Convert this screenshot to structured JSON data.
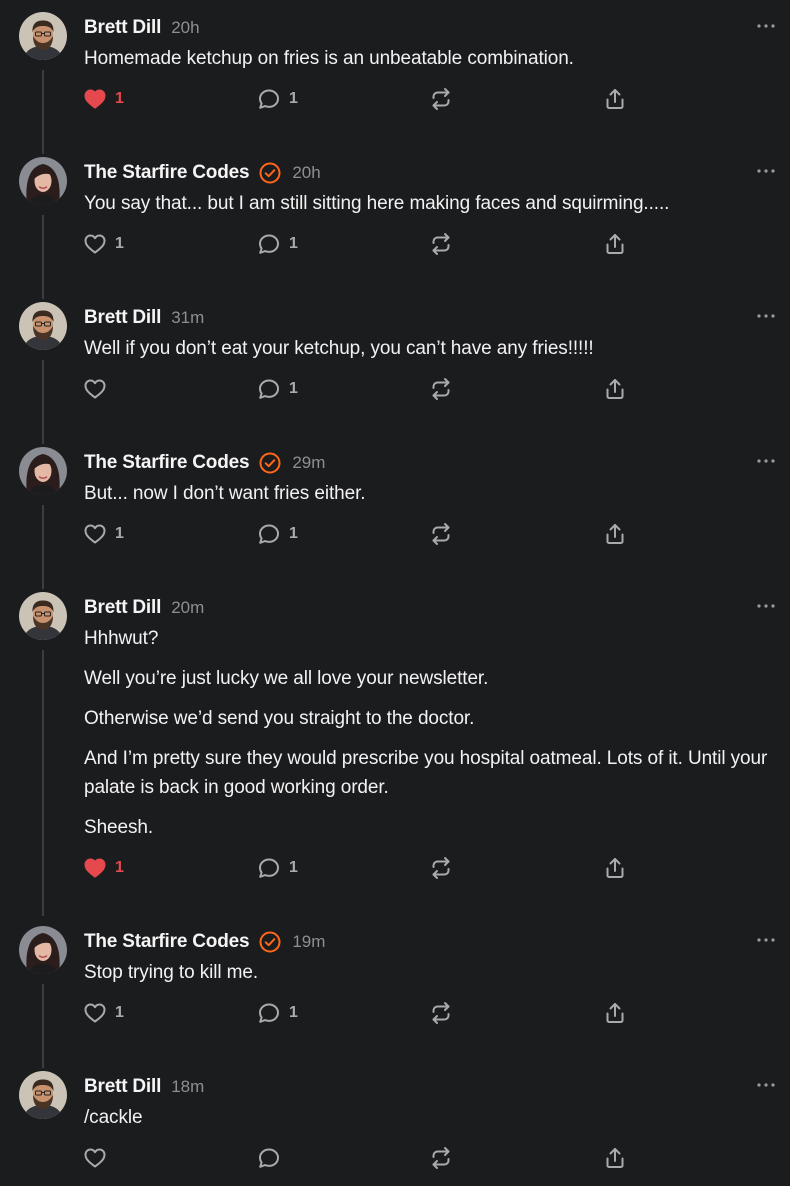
{
  "colors": {
    "background": "#1b1c1e",
    "text": "#f2f2f2",
    "muted": "#8e8f93",
    "like_active": "#e5484d",
    "verified_accent": "#ff6719",
    "thread_line": "#3c3d40"
  },
  "comments": [
    {
      "author": "Brett Dill",
      "time": "20h",
      "verified": false,
      "avatar": "bearded-man-avatar",
      "paragraphs": [
        "Homemade ketchup on fries is an unbeatable combination."
      ],
      "likes": "1",
      "liked": true,
      "replies": "1"
    },
    {
      "author": "The Starfire Codes",
      "time": "20h",
      "verified": true,
      "avatar": "dark-haired-woman-avatar",
      "paragraphs": [
        "You say that... but I am still sitting here making faces and squirming....."
      ],
      "likes": "1",
      "liked": false,
      "replies": "1"
    },
    {
      "author": "Brett Dill",
      "time": "31m",
      "verified": false,
      "avatar": "bearded-man-avatar",
      "paragraphs": [
        "Well if you don’t eat your ketchup, you can’t have any fries!!!!!"
      ],
      "likes": "",
      "liked": false,
      "replies": "1"
    },
    {
      "author": "The Starfire Codes",
      "time": "29m",
      "verified": true,
      "avatar": "dark-haired-woman-avatar",
      "paragraphs": [
        "But... now I don’t want fries either."
      ],
      "likes": "1",
      "liked": false,
      "replies": "1"
    },
    {
      "author": "Brett Dill",
      "time": "20m",
      "verified": false,
      "avatar": "bearded-man-avatar",
      "paragraphs": [
        "Hhhwut?",
        "Well you’re just lucky we all love your newsletter.",
        "Otherwise we’d send you straight to the doctor.",
        "And I’m pretty sure they would prescribe you hospital oatmeal. Lots of it. Until your palate is back in good working order.",
        "Sheesh."
      ],
      "likes": "1",
      "liked": true,
      "replies": "1"
    },
    {
      "author": "The Starfire Codes",
      "time": "19m",
      "verified": true,
      "avatar": "dark-haired-woman-avatar",
      "paragraphs": [
        "Stop trying to kill me."
      ],
      "likes": "1",
      "liked": false,
      "replies": "1"
    },
    {
      "author": "Brett Dill",
      "time": "18m",
      "verified": false,
      "avatar": "bearded-man-avatar",
      "paragraphs": [
        "/cackle"
      ],
      "likes": "",
      "liked": false,
      "replies": ""
    }
  ]
}
